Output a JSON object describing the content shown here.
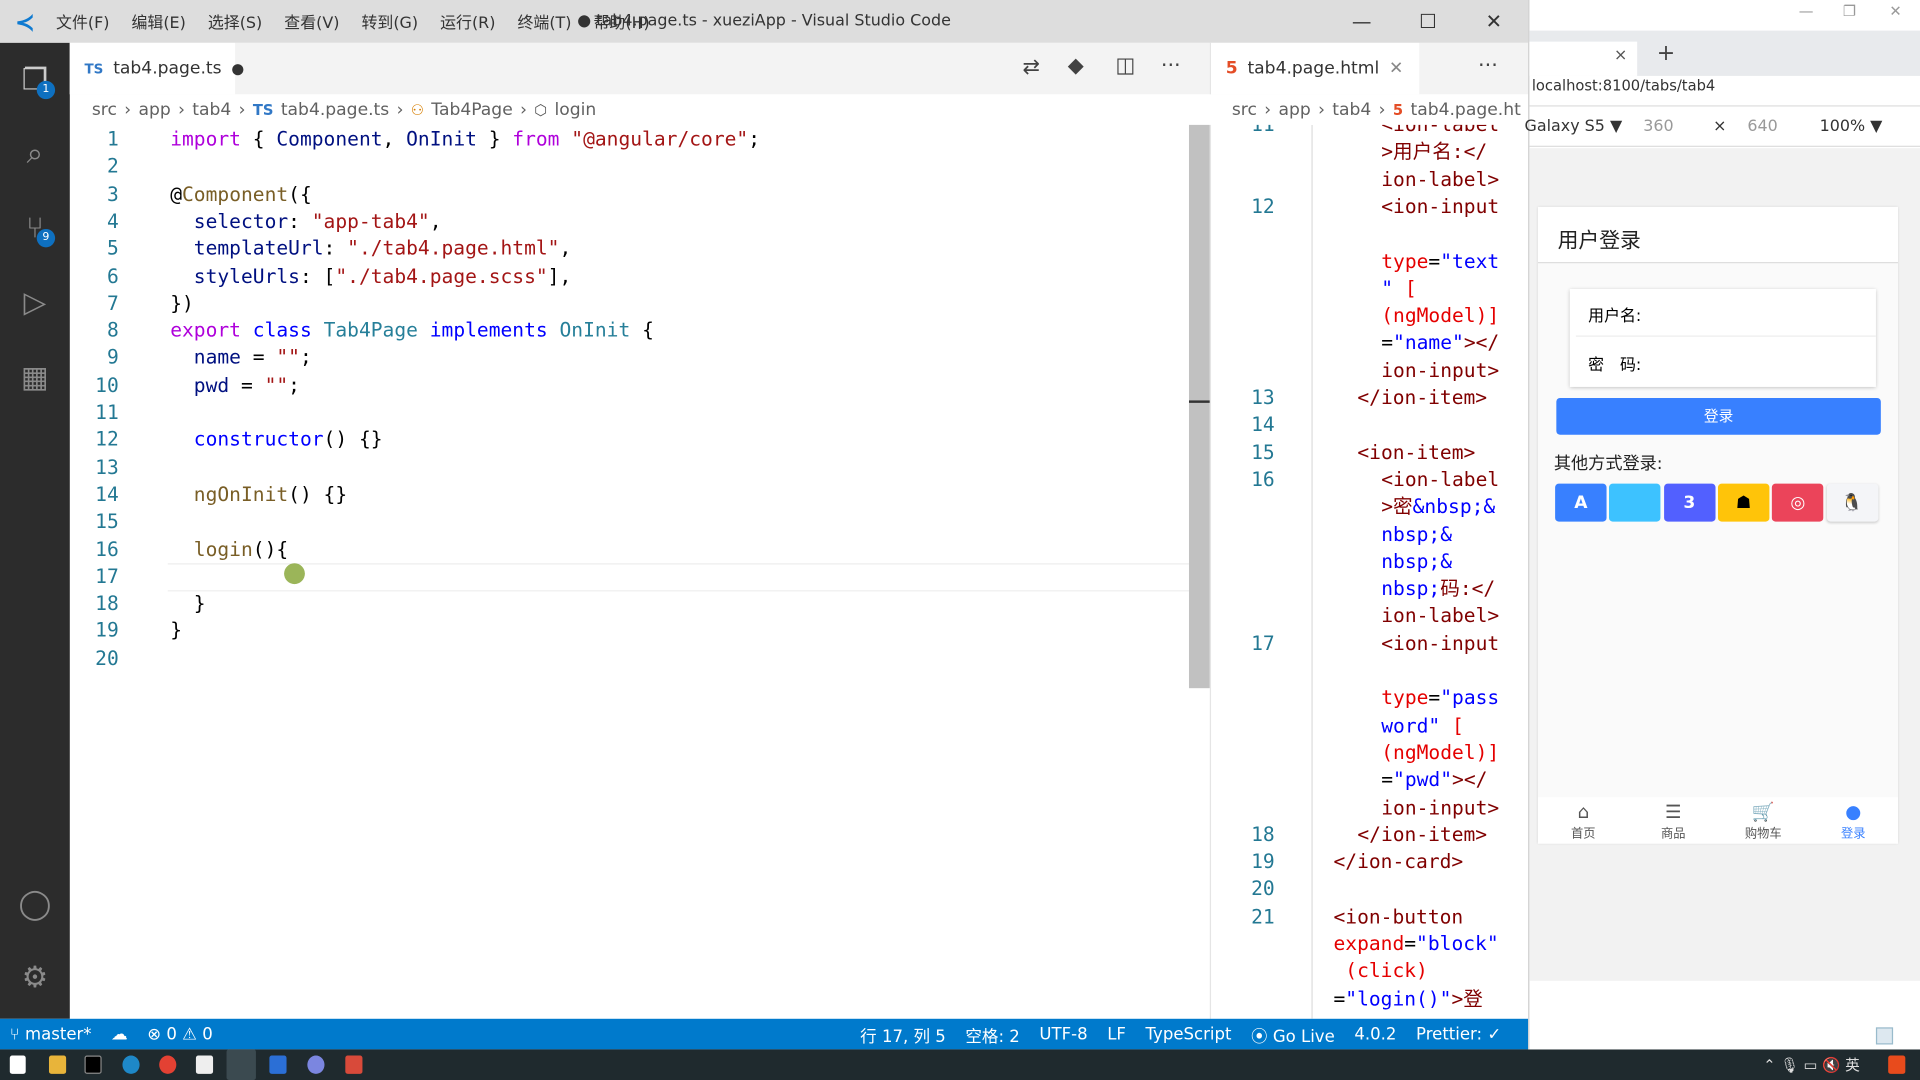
{
  "window": {
    "title": "● tab4.page.ts - xueziApp - Visual Studio Code",
    "menu": [
      "文件(F)",
      "编辑(E)",
      "选择(S)",
      "查看(V)",
      "转到(G)",
      "运行(R)",
      "终端(T)",
      "帮助(H)"
    ]
  },
  "activity": {
    "explorer_badge": "1",
    "scm_badge": "9"
  },
  "editor_left": {
    "tab": {
      "lang": "TS",
      "name": "tab4.page.ts"
    },
    "breadcrumbs": [
      "src",
      "app",
      "tab4",
      "tab4.page.ts",
      "Tab4Page",
      "login"
    ],
    "lines": [
      [
        [
          "import",
          "kw"
        ],
        [
          " { ",
          "pl"
        ],
        [
          "Component",
          "va"
        ],
        [
          ", ",
          "pl"
        ],
        [
          "OnInit",
          "va"
        ],
        [
          " } ",
          "pl"
        ],
        [
          "from",
          "kw"
        ],
        [
          " ",
          "pl"
        ],
        [
          "\"@angular/core\"",
          "st"
        ],
        [
          ";",
          "pl"
        ]
      ],
      [],
      [
        [
          "@",
          "pl"
        ],
        [
          "Component",
          "fn"
        ],
        [
          "({",
          "pl"
        ]
      ],
      [
        [
          "  ",
          "pl"
        ],
        [
          "selector",
          "va"
        ],
        [
          ": ",
          "pl"
        ],
        [
          "\"app-tab4\"",
          "st"
        ],
        [
          ",",
          "pl"
        ]
      ],
      [
        [
          "  ",
          "pl"
        ],
        [
          "templateUrl",
          "va"
        ],
        [
          ": ",
          "pl"
        ],
        [
          "\"./tab4.page.html\"",
          "st"
        ],
        [
          ",",
          "pl"
        ]
      ],
      [
        [
          "  ",
          "pl"
        ],
        [
          "styleUrls",
          "va"
        ],
        [
          ": [",
          "pl"
        ],
        [
          "\"./tab4.page.scss\"",
          "st"
        ],
        [
          "],",
          "pl"
        ]
      ],
      [
        [
          "})",
          "pl"
        ]
      ],
      [
        [
          "export",
          "kw"
        ],
        [
          " ",
          "pl"
        ],
        [
          "class",
          "kb"
        ],
        [
          " ",
          "pl"
        ],
        [
          "Tab4Page",
          "ty"
        ],
        [
          " ",
          "pl"
        ],
        [
          "implements",
          "kb"
        ],
        [
          " ",
          "pl"
        ],
        [
          "OnInit",
          "ty"
        ],
        [
          " {",
          "pl"
        ]
      ],
      [
        [
          "  ",
          "pl"
        ],
        [
          "name",
          "va"
        ],
        [
          " = ",
          "pl"
        ],
        [
          "\"\"",
          "st"
        ],
        [
          ";",
          "pl"
        ]
      ],
      [
        [
          "  ",
          "pl"
        ],
        [
          "pwd",
          "va"
        ],
        [
          " = ",
          "pl"
        ],
        [
          "\"\"",
          "st"
        ],
        [
          ";",
          "pl"
        ]
      ],
      [],
      [
        [
          "  ",
          "pl"
        ],
        [
          "constructor",
          "kb"
        ],
        [
          "() {}",
          "pl"
        ]
      ],
      [],
      [
        [
          "  ",
          "pl"
        ],
        [
          "ngOnInit",
          "fn"
        ],
        [
          "() {}",
          "pl"
        ]
      ],
      [],
      [
        [
          "  ",
          "pl"
        ],
        [
          "login",
          "fn"
        ],
        [
          "(){",
          "pl"
        ]
      ],
      [],
      [
        [
          "  }",
          "pl"
        ]
      ],
      [
        [
          "}",
          "pl"
        ]
      ],
      []
    ]
  },
  "editor_right": {
    "tab": {
      "name": "tab4.page.html"
    },
    "breadcrumbs": [
      "src",
      "app",
      "tab4",
      "tab4.page.ht"
    ],
    "rows": [
      {
        "n": "11",
        "i": 2,
        "t": [
          [
            "<ion-label",
            "tg"
          ]
        ]
      },
      {
        "n": "",
        "i": 2,
        "t": [
          [
            ">用户名:</",
            "tg"
          ]
        ]
      },
      {
        "n": "",
        "i": 2,
        "t": [
          [
            "ion-label>",
            "tg"
          ]
        ]
      },
      {
        "n": "12",
        "i": 2,
        "t": [
          [
            "<ion-input",
            "tg"
          ]
        ]
      },
      {
        "n": "",
        "i": 2,
        "t": []
      },
      {
        "n": "",
        "i": 2,
        "t": [
          [
            "type",
            "at"
          ],
          [
            "=",
            "pl"
          ],
          [
            "\"text",
            "hv"
          ]
        ]
      },
      {
        "n": "",
        "i": 2,
        "t": [
          [
            "\"",
            "hv"
          ],
          [
            " [",
            "at"
          ]
        ]
      },
      {
        "n": "",
        "i": 2,
        "t": [
          [
            "(ngModel)]",
            "at"
          ]
        ]
      },
      {
        "n": "",
        "i": 2,
        "t": [
          [
            "=",
            "pl"
          ],
          [
            "\"name\"",
            "hv"
          ],
          [
            "></",
            "tg"
          ]
        ]
      },
      {
        "n": "",
        "i": 2,
        "t": [
          [
            "ion-input>",
            "tg"
          ]
        ]
      },
      {
        "n": "13",
        "i": 1,
        "t": [
          [
            "</ion-item>",
            "tg"
          ]
        ]
      },
      {
        "n": "14",
        "i": 1,
        "t": []
      },
      {
        "n": "15",
        "i": 1,
        "t": [
          [
            "<ion-item>",
            "tg"
          ]
        ]
      },
      {
        "n": "16",
        "i": 2,
        "t": [
          [
            "<ion-label",
            "tg"
          ]
        ]
      },
      {
        "n": "",
        "i": 2,
        "t": [
          [
            ">密",
            "tg"
          ],
          [
            "&nbsp;&",
            "hv"
          ]
        ]
      },
      {
        "n": "",
        "i": 2,
        "t": [
          [
            "nbsp;&",
            "hv"
          ]
        ]
      },
      {
        "n": "",
        "i": 2,
        "t": [
          [
            "nbsp;&",
            "hv"
          ]
        ]
      },
      {
        "n": "",
        "i": 2,
        "t": [
          [
            "nbsp;",
            "hv"
          ],
          [
            "码:</",
            "tg"
          ]
        ]
      },
      {
        "n": "",
        "i": 2,
        "t": [
          [
            "ion-label>",
            "tg"
          ]
        ]
      },
      {
        "n": "17",
        "i": 2,
        "t": [
          [
            "<ion-input",
            "tg"
          ]
        ]
      },
      {
        "n": "",
        "i": 2,
        "t": []
      },
      {
        "n": "",
        "i": 2,
        "t": [
          [
            "type",
            "at"
          ],
          [
            "=",
            "pl"
          ],
          [
            "\"pass",
            "hv"
          ]
        ]
      },
      {
        "n": "",
        "i": 2,
        "t": [
          [
            "word\"",
            "hv"
          ],
          [
            " [",
            "at"
          ]
        ]
      },
      {
        "n": "",
        "i": 2,
        "t": [
          [
            "(ngModel)]",
            "at"
          ]
        ]
      },
      {
        "n": "",
        "i": 2,
        "t": [
          [
            "=",
            "pl"
          ],
          [
            "\"pwd\"",
            "hv"
          ],
          [
            "></",
            "tg"
          ]
        ]
      },
      {
        "n": "",
        "i": 2,
        "t": [
          [
            "ion-input>",
            "tg"
          ]
        ]
      },
      {
        "n": "18",
        "i": 1,
        "t": [
          [
            "</ion-item>",
            "tg"
          ]
        ]
      },
      {
        "n": "19",
        "i": 0,
        "t": [
          [
            "</ion-card>",
            "tg"
          ]
        ]
      },
      {
        "n": "20",
        "i": 0,
        "t": []
      },
      {
        "n": "21",
        "i": 0,
        "t": [
          [
            "<ion-button",
            "tg"
          ]
        ]
      },
      {
        "n": "",
        "i": 0,
        "t": [
          [
            "expand",
            "at"
          ],
          [
            "=",
            "pl"
          ],
          [
            "\"block\"",
            "hv"
          ]
        ]
      },
      {
        "n": "",
        "i": 0,
        "t": [
          [
            " (click)",
            "at"
          ]
        ]
      },
      {
        "n": "",
        "i": 0,
        "t": [
          [
            "=",
            "pl"
          ],
          [
            "\"login()\"",
            "hv"
          ],
          [
            ">登",
            "tg"
          ]
        ]
      }
    ]
  },
  "statusbar": {
    "branch": "master*",
    "errors": "0",
    "warnings": "0",
    "position": "行 17, 列 5",
    "spaces": "空格: 2",
    "encoding": "UTF-8",
    "eol": "LF",
    "language": "TypeScript",
    "golive": "Go Live",
    "version": "4.0.2",
    "prettier": "Prettier: ✓"
  },
  "browser": {
    "url": "localhost:8100/tabs/tab4",
    "device": "Galaxy S5 ▼",
    "width": "360",
    "height": "640",
    "zoom": "100% ▼",
    "page": {
      "header": "用户登录",
      "username_label": "用户名:",
      "password_label": "密　码:",
      "login_button": "登录",
      "other_login": "其他方式登录:",
      "social": [
        {
          "icon": "angular-icon",
          "color": "#3880ff"
        },
        {
          "icon": "apple-icon",
          "color": "#3dc2ff"
        },
        {
          "icon": "css3-icon",
          "color": "#5260ff"
        },
        {
          "icon": "android-icon",
          "color": "#ffc409"
        },
        {
          "icon": "github-icon",
          "color": "#eb445a"
        },
        {
          "icon": "linux-icon",
          "color": "#f4f5f8"
        }
      ],
      "tabs": [
        {
          "label": "首页",
          "icon": "home-icon"
        },
        {
          "label": "商品",
          "icon": "list-icon"
        },
        {
          "label": "购物车",
          "icon": "cart-icon"
        },
        {
          "label": "登录",
          "icon": "person-icon",
          "active": true
        }
      ]
    }
  },
  "colors": {
    "accent": "#007acc",
    "ionic_primary": "#3880ff"
  }
}
